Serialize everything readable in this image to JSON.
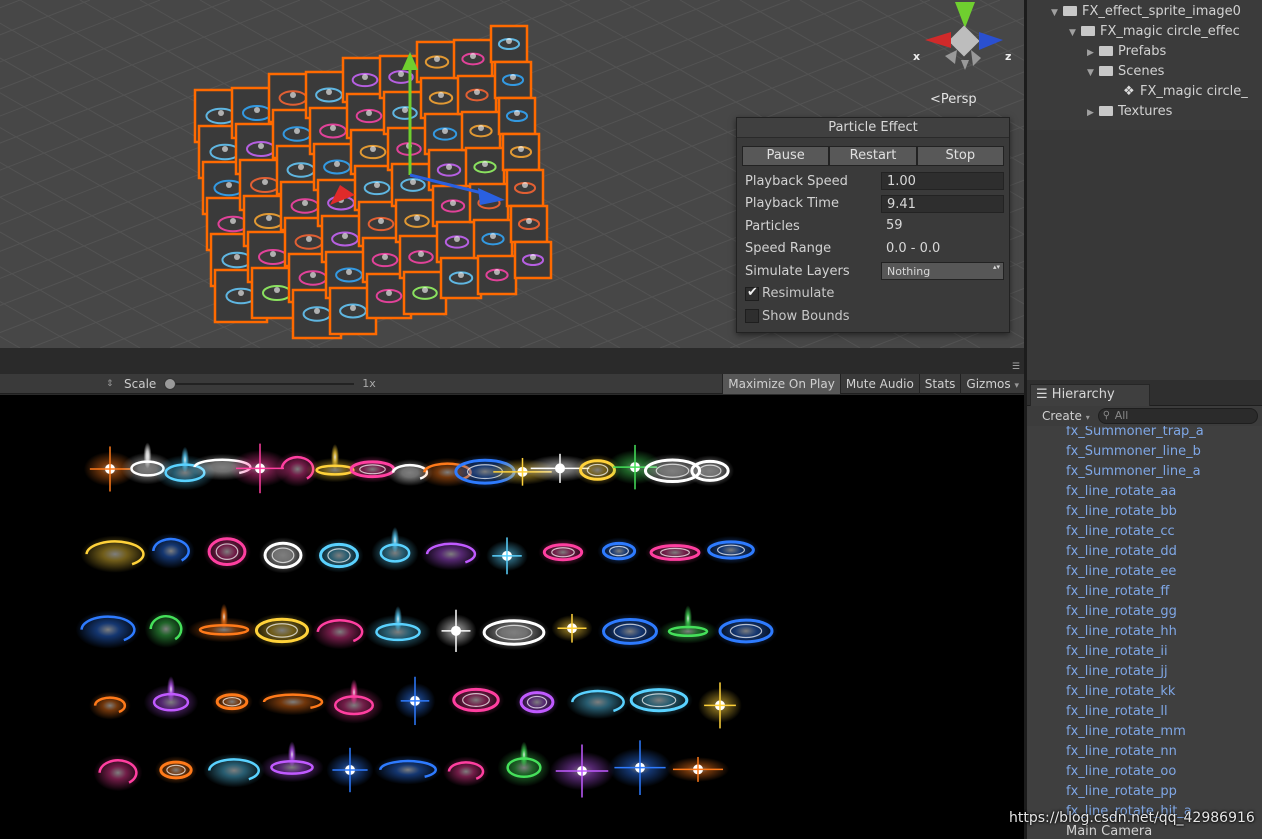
{
  "scene": {
    "persp_label": "Persp",
    "axis_x": "x",
    "axis_z": "z"
  },
  "particle_effect": {
    "title": "Particle Effect",
    "buttons": {
      "pause": "Pause",
      "restart": "Restart",
      "stop": "Stop"
    },
    "playback_speed": {
      "label": "Playback Speed",
      "value": "1.00"
    },
    "playback_time": {
      "label": "Playback Time",
      "value": "9.41"
    },
    "particles": {
      "label": "Particles",
      "value": "59"
    },
    "speed_range": {
      "label": "Speed Range",
      "value": "0.0 - 0.0"
    },
    "simulate_layers": {
      "label": "Simulate Layers",
      "value": "Nothing"
    },
    "resimulate": {
      "label": "Resimulate",
      "checked": true
    },
    "show_bounds": {
      "label": "Show Bounds",
      "checked": false
    }
  },
  "game_toolbar": {
    "scale_label": "Scale",
    "scale_value": "1x",
    "scale_level": 0,
    "maximize_on_play": "Maximize On Play",
    "mute_audio": "Mute Audio",
    "stats": "Stats",
    "gizmos": "Gizmos"
  },
  "project_tree": {
    "items": [
      {
        "label": "FX_effect_sprite_image0",
        "expanded": true
      },
      {
        "label": "FX_magic circle_effec",
        "expanded": true
      },
      {
        "label": "Prefabs",
        "expanded": false
      },
      {
        "label": "Scenes",
        "expanded": true
      },
      {
        "label": "FX_magic circle_"
      },
      {
        "label": "Textures",
        "expanded": false
      }
    ]
  },
  "hierarchy": {
    "tab_label": "Hierarchy",
    "create_label": "Create",
    "search_placeholder": "All",
    "items": [
      "fx_Summoner_trap_a",
      "fx_Summoner_line_b",
      "fx_Summoner_line_a",
      "fx_line_rotate_aa",
      "fx_line_rotate_bb",
      "fx_line_rotate_cc",
      "fx_line_rotate_dd",
      "fx_line_rotate_ee",
      "fx_line_rotate_ff",
      "fx_line_rotate_gg",
      "fx_line_rotate_hh",
      "fx_line_rotate_ii",
      "fx_line_rotate_jj",
      "fx_line_rotate_kk",
      "fx_line_rotate_ll",
      "fx_line_rotate_mm",
      "fx_line_rotate_nn",
      "fx_line_rotate_oo",
      "fx_line_rotate_pp",
      "fx_line_rotate_hit_a",
      "Main Camera"
    ]
  },
  "watermark": "https://blog.csdn.net/qq_42986916",
  "colors": {
    "hierarchy_link": "#7fa7e6",
    "selection_orange": "#ff6a00",
    "scene_bg": "#474747"
  }
}
